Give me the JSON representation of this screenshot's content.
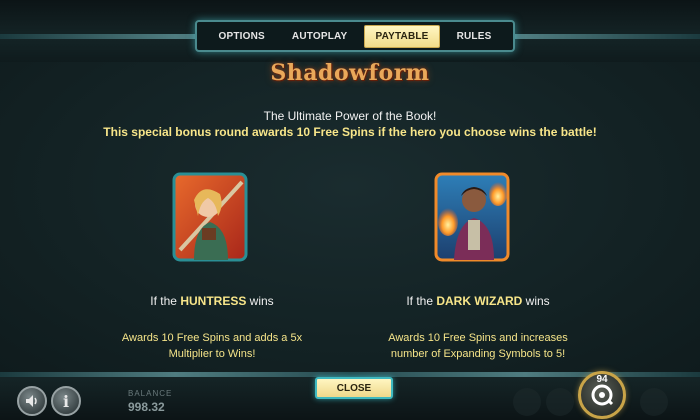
{
  "tabs": [
    {
      "label": "OPTIONS",
      "active": false
    },
    {
      "label": "AUTOPLAY",
      "active": false
    },
    {
      "label": "PAYTABLE",
      "active": true
    },
    {
      "label": "RULES",
      "active": false
    }
  ],
  "logo_text": "Shadowform",
  "headline": "The Ultimate Power of the Book!",
  "subline": "This special bonus round awards 10 Free Spins if the hero you choose wins the battle!",
  "heroes": [
    {
      "caption_prefix": "If the ",
      "name": "HUNTRESS",
      "caption_suffix": " wins",
      "desc_line1": "Awards 10 Free Spins and adds a 5x",
      "desc_line2": "Multiplier to Wins!",
      "icon": "huntress-portrait"
    },
    {
      "caption_prefix": "If the ",
      "name": "DARK WIZARD",
      "caption_suffix": " wins",
      "desc_line1": "Awards 10 Free Spins and increases",
      "desc_line2": "number of Expanding Symbols to 5!",
      "icon": "dark-wizard-portrait"
    }
  ],
  "bottom": {
    "close_label": "CLOSE",
    "balance_label": "BALANCE",
    "balance_value": "998.32",
    "spin_count": "94",
    "sound_icon": "speaker-icon",
    "info_icon": "info-icon",
    "spin_icon": "spin-icon"
  },
  "colors": {
    "accent_gold": "#f8e68a",
    "frame_teal": "#4a8a8e",
    "active_tab": "#f2dc8a",
    "logo_orange": "#e9a85a"
  }
}
